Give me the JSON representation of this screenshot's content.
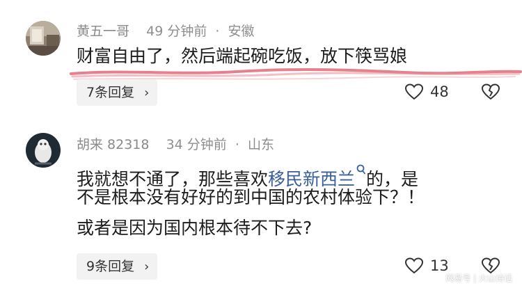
{
  "comments": [
    {
      "username": "黄五一哥",
      "time": "49 分钟前",
      "separator": "·",
      "location": "安徽",
      "text_lines": [
        "财富自由了，然后端起碗吃饭，放下筷骂娘"
      ],
      "replies_label": "7条回复",
      "like_count": "48"
    },
    {
      "username": "胡来 82318",
      "time": "34 分钟前",
      "separator": "·",
      "location": "山东",
      "line1_before": "我就想不通了，那些喜欢",
      "line1_link": "移民新西兰",
      "line1_after": "的，是",
      "line2": "不是根本没有好好的到中国的农村体验下？！",
      "line3": "或者是因为国内根本待不下去?",
      "replies_label": "9条回复",
      "like_count": "13"
    }
  ],
  "watermark": "网易号 | 火山诗话",
  "colors": {
    "underline": "#e06a78",
    "link": "#3a5f9e"
  }
}
